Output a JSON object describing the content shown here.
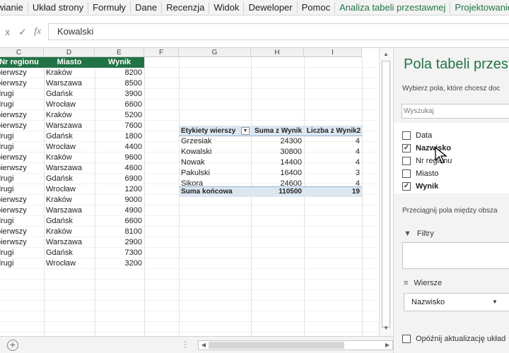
{
  "ribbon": {
    "tabs": [
      "wianie",
      "Układ strony",
      "Formuły",
      "Dane",
      "Recenzja",
      "Widok",
      "Deweloper",
      "Pomoc",
      "Analiza tabeli przestawnej",
      "Projektowanie"
    ]
  },
  "formula_bar": {
    "cancel_icon": "x",
    "enter_icon": "✓",
    "fx_label": "fx",
    "value": "Kowalski"
  },
  "grid": {
    "column_headers": [
      "C",
      "D",
      "E",
      "F",
      "G",
      "H",
      "I"
    ],
    "source_table": {
      "headers": [
        "Nr regionu",
        "Miasto",
        "Wynik"
      ],
      "rows": [
        [
          "pierwszy",
          "Kraków",
          "8200"
        ],
        [
          "pierwszy",
          "Warszawa",
          "8500"
        ],
        [
          "drugi",
          "Gdańsk",
          "3900"
        ],
        [
          "drugi",
          "Wrocław",
          "6600"
        ],
        [
          "pierwszy",
          "Kraków",
          "5200"
        ],
        [
          "pierwszy",
          "Warszawa",
          "7600"
        ],
        [
          "drugi",
          "Gdańsk",
          "1800"
        ],
        [
          "drugi",
          "Wrocław",
          "4400"
        ],
        [
          "pierwszy",
          "Kraków",
          "9600"
        ],
        [
          "pierwszy",
          "Warszawa",
          "4600"
        ],
        [
          "drugi",
          "Gdańsk",
          "6900"
        ],
        [
          "drugi",
          "Wrocław",
          "1200"
        ],
        [
          "pierwszy",
          "Kraków",
          "9000"
        ],
        [
          "pierwszy",
          "Warszawa",
          "4900"
        ],
        [
          "drugi",
          "Gdańsk",
          "6600"
        ],
        [
          "pierwszy",
          "Kraków",
          "8100"
        ],
        [
          "pierwszy",
          "Warszawa",
          "2900"
        ],
        [
          "drugi",
          "Gdańsk",
          "7300"
        ],
        [
          "drugi",
          "Wrocław",
          "3200"
        ]
      ]
    },
    "pivot": {
      "headers": [
        "Etykiety wierszy",
        "Suma z Wynik",
        "Liczba z Wynik2"
      ],
      "rows": [
        [
          "Grzesiak",
          "24300",
          "4"
        ],
        [
          "Kowalski",
          "30800",
          "4"
        ],
        [
          "Nowak",
          "14400",
          "4"
        ],
        [
          "Pakulski",
          "16400",
          "3"
        ],
        [
          "Sikora",
          "24600",
          "4"
        ]
      ],
      "total": [
        "Suma końcowa",
        "110500",
        "19"
      ]
    }
  },
  "pane": {
    "title": "Pola tabeli przest",
    "subtitle": "Wybierz pola, które chcesz doc",
    "search_placeholder": "Wyszukaj",
    "fields": [
      {
        "label": "Data",
        "checked": false
      },
      {
        "label": "Nazwisko",
        "checked": true
      },
      {
        "label": "Nr regionu",
        "checked": false
      },
      {
        "label": "Miasto",
        "checked": false
      },
      {
        "label": "Wynik",
        "checked": true
      }
    ],
    "drag_hint": "Przeciągnij pola między obsza",
    "filters_label": "Filtry",
    "rows_label": "Wiersze",
    "rows_item": "Nazwisko",
    "defer_label": "Opóźnij aktualizację układ"
  },
  "colors": {
    "accent": "#217346",
    "pivot_header_bg": "#dce6f1"
  }
}
